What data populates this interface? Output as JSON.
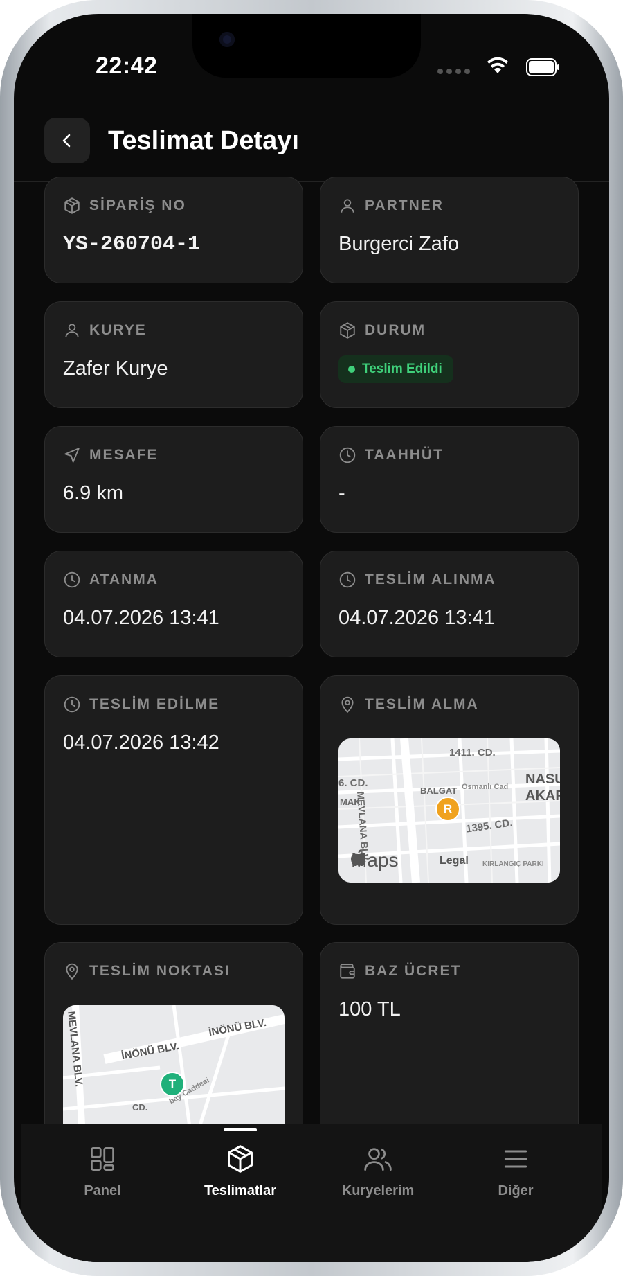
{
  "status_bar": {
    "time": "22:42"
  },
  "header": {
    "title": "Teslimat Detayı"
  },
  "cards": {
    "order": {
      "label": "SİPARİŞ NO",
      "value": "YS-260704-1"
    },
    "partner": {
      "label": "PARTNER",
      "value": "Burgerci Zafo"
    },
    "courier": {
      "label": "KURYE",
      "value": "Zafer Kurye"
    },
    "status": {
      "label": "DURUM",
      "value": "Teslim Edildi",
      "color": "#3fd07a"
    },
    "distance": {
      "label": "MESAFE",
      "value": "6.9 km"
    },
    "commitment": {
      "label": "TAAHHÜT",
      "value": "-"
    },
    "assigned": {
      "label": "ATANMA",
      "value": "04.07.2026 13:41"
    },
    "picked_up": {
      "label": "TESLİM ALINMA",
      "value": "04.07.2026 13:41"
    },
    "delivered": {
      "label": "TESLİM EDİLME",
      "value": "04.07.2026 13:42"
    },
    "pickup_location": {
      "label": "TESLİM ALMA",
      "map": {
        "pin": "R",
        "pin_color": "#f0a21e",
        "labels": [
          "1411. CD.",
          "NASU",
          "AKAR",
          "BALGAT",
          "Osmanlı Cad",
          "MEVLANA BLV.",
          "6. CD.",
          "MAK",
          "1395. CD.",
          "KIRLANGIÇ PARKI"
        ],
        "brand": "Maps",
        "legal": "Legal"
      }
    },
    "dropoff_location": {
      "label": "TESLİM NOKTASI",
      "map": {
        "pin": "T",
        "pin_color": "#1fb07a",
        "labels": [
          "İNÖNÜ BLV.",
          "İNÖNÜ BLV.",
          "MEVLANA BLV.",
          "CD.",
          "bay Caddesi"
        ]
      }
    },
    "base_fee": {
      "label": "BAZ ÜCRET",
      "value": "100 TL"
    }
  },
  "tabbar": {
    "items": [
      {
        "label": "Panel",
        "icon": "grid-icon"
      },
      {
        "label": "Teslimatlar",
        "icon": "box-icon",
        "active": true
      },
      {
        "label": "Kuryelerim",
        "icon": "users-icon"
      },
      {
        "label": "Diğer",
        "icon": "menu-icon"
      }
    ]
  }
}
